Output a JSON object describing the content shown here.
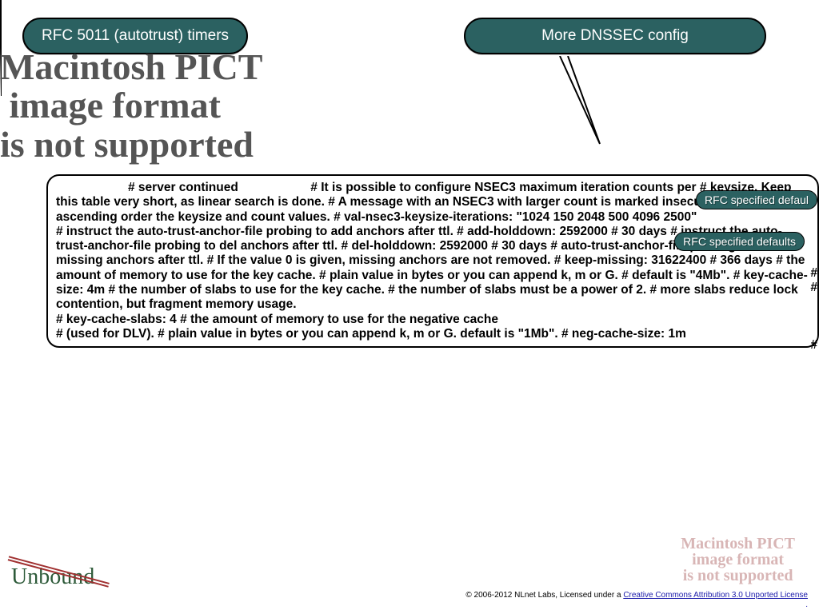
{
  "callouts": {
    "left": "RFC 5011 (autotrust) timers",
    "right": "More DNSSEC config"
  },
  "tags": {
    "tag1": "RFC specified defaul",
    "tag2": "RFC specified defaults"
  },
  "error_big_line1": "Macintosh PICT",
  "error_big_line2": "image format",
  "error_big_line3": "is not supported",
  "error_small_line1": "Macintosh PICT",
  "error_small_line2": "image format",
  "error_small_line3": "is not supported",
  "code": {
    "l1a": "# server continued",
    "l1b": "# It is possible to configure NSEC3 maximum iteration counts",
    "l2": "per        # keysize. Keep this table very short, as linear search is done.   # A message with an NSEC3 with larger count is marked insecure.          # List in ascending order the keysize and count values.  # val-nsec3-keysize-iterations: \"1024 150 2048 500 4096 2500\"",
    "l3": "            # instruct the auto-trust-anchor-file probing to add anchors after ttl.                # add-holddown: 2592000 # 30 days        # instruct the auto-trust-anchor-file probing to del anchors after ttl.         # del-holddown: 2592000 # 30 days    # auto-trust-anchor-file probing removes missing anchors after ttl.          # If the value 0 is given, missing anchors are not removed.                # keep-missing: 31622400 # 366 days   # the amount of memory to use for the key cache. # plain value in bytes or you can append k, m or G.   # default is \"4Mb\".           # key-cache-size: 4m    # the number of slabs to use for the key cache.  # the number of slabs must be a power of 2.   # more slabs reduce lock contention, but fragment memory usage.",
    "l4": "            # key-cache-slabs: 4      # the amount of memory to use for the negative cache",
    "l5": "            # (used for DLV).            # plain value in bytes or you can append k, m or G. default is \"1Mb\".      # neg-cache-size: 1m"
  },
  "overflow": {
    "h1": "#",
    "h2": "#",
    "h3": "#"
  },
  "logo_text": "Unbound",
  "footer": {
    "prefix": "© 2006-2012 NLnet Labs, Licensed under a ",
    "link": "Creative Commons Attribution 3.0 Unported License",
    "suffix": "."
  }
}
